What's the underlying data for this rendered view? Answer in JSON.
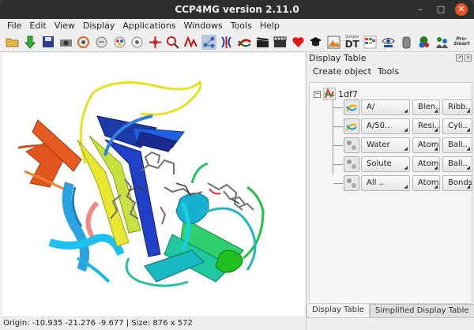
{
  "window": {
    "title": "CCP4MG version 2.11.0"
  },
  "menubar": {
    "items": [
      "File",
      "Edit",
      "View",
      "Display",
      "Applications",
      "Windows",
      "Tools",
      "Help"
    ]
  },
  "toolbar": {
    "icons": [
      "open-folder-icon",
      "download-icon",
      "save-icon",
      "camera-icon",
      "undo-view-icon",
      "view-reset-icon",
      "picture-wizard-icon",
      "lighting-icon",
      "center-icon",
      "find-icon",
      "sequence-icon",
      "select-icon",
      "symmetry-icon",
      "superpose-icon",
      "movie-icon",
      "clapper-icon",
      "favourite-heart-icon",
      "graduation-icon",
      "picture-icon",
      "simple-dt-icon",
      "mg-icon",
      "eye-pdb-icon",
      "hand-icon",
      "bio-icon",
      "people-icon",
      "pro-smart-icon"
    ],
    "active_index": 11,
    "simple_dt_label": "DT",
    "pro_smart_label": "Pro-Smart"
  },
  "status": {
    "text": "Origin: -10.935 -21.276 -9.677 | Size: 876 x 572"
  },
  "panel": {
    "title": "Display Table",
    "menus": [
      "Create object",
      "Tools"
    ],
    "root": {
      "expander": "−",
      "label": "1df7"
    },
    "rows": [
      {
        "sel": "A/",
        "style": "Blen..",
        "rep": "Ribb.."
      },
      {
        "sel": "A/50..",
        "style": "Resi..",
        "rep": "Cyli.."
      },
      {
        "sel": "Water",
        "style": "Atom..",
        "rep": "Ball.."
      },
      {
        "sel": "Solute",
        "style": "Atom..",
        "rep": "Ball.."
      },
      {
        "sel": "All ..",
        "style": "Atom..",
        "rep": "Bonds"
      }
    ],
    "tabs": [
      "Display Table",
      "Simplified Display Table"
    ]
  },
  "colors": {
    "titlebar": "#2e2e2e",
    "close": "#e95420",
    "viewport": "#ffffff"
  }
}
